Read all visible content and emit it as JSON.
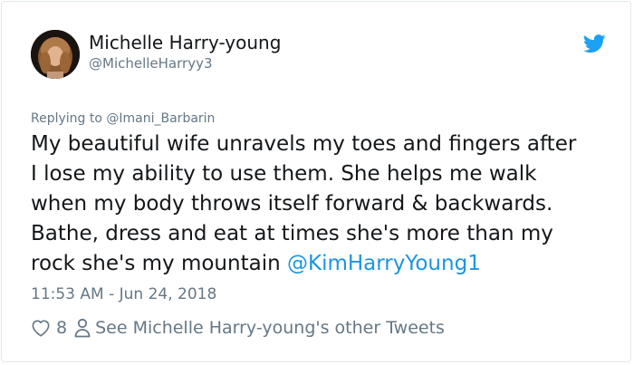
{
  "author": {
    "display_name": "Michelle Harry-young",
    "handle": "@MichelleHarryy3"
  },
  "reply": {
    "prefix": "Replying to ",
    "to": "@Imani_Barbarin"
  },
  "tweet": {
    "lines": [
      "My beautiful wife unravels my toes and fingers after",
      "I lose my ability to use them. She helps me walk",
      "when my body throws itself forward & backwards.",
      "Bathe, dress and eat at times she's more than my",
      "rock she's my mountain "
    ],
    "mention": "@KimHarryYoung1",
    "timestamp": "11:53 AM - Jun 24, 2018"
  },
  "actions": {
    "like_count": "8",
    "other_tweets_label": "See Michelle Harry-young's other Tweets"
  },
  "icons": {
    "brand": "twitter-bird-icon",
    "like": "heart-icon",
    "profile": "person-icon"
  },
  "colors": {
    "twitter_blue": "#1da1f2",
    "link": "#1b95e0",
    "secondary_text": "#657786",
    "primary_text": "#14171a"
  }
}
